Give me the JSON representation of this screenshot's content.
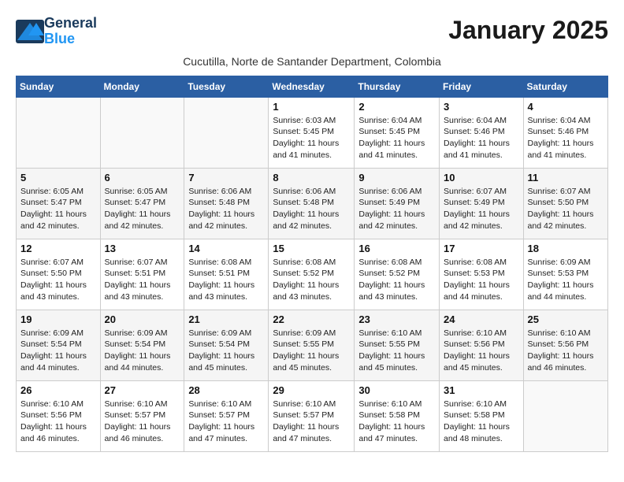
{
  "header": {
    "logo_line1": "General",
    "logo_line2": "Blue",
    "title": "January 2025",
    "subtitle": "Cucutilla, Norte de Santander Department, Colombia"
  },
  "weekdays": [
    "Sunday",
    "Monday",
    "Tuesday",
    "Wednesday",
    "Thursday",
    "Friday",
    "Saturday"
  ],
  "weeks": [
    [
      {
        "day": "",
        "sunrise": "",
        "sunset": "",
        "daylight": ""
      },
      {
        "day": "",
        "sunrise": "",
        "sunset": "",
        "daylight": ""
      },
      {
        "day": "",
        "sunrise": "",
        "sunset": "",
        "daylight": ""
      },
      {
        "day": "1",
        "sunrise": "Sunrise: 6:03 AM",
        "sunset": "Sunset: 5:45 PM",
        "daylight": "Daylight: 11 hours and 41 minutes."
      },
      {
        "day": "2",
        "sunrise": "Sunrise: 6:04 AM",
        "sunset": "Sunset: 5:45 PM",
        "daylight": "Daylight: 11 hours and 41 minutes."
      },
      {
        "day": "3",
        "sunrise": "Sunrise: 6:04 AM",
        "sunset": "Sunset: 5:46 PM",
        "daylight": "Daylight: 11 hours and 41 minutes."
      },
      {
        "day": "4",
        "sunrise": "Sunrise: 6:04 AM",
        "sunset": "Sunset: 5:46 PM",
        "daylight": "Daylight: 11 hours and 41 minutes."
      }
    ],
    [
      {
        "day": "5",
        "sunrise": "Sunrise: 6:05 AM",
        "sunset": "Sunset: 5:47 PM",
        "daylight": "Daylight: 11 hours and 42 minutes."
      },
      {
        "day": "6",
        "sunrise": "Sunrise: 6:05 AM",
        "sunset": "Sunset: 5:47 PM",
        "daylight": "Daylight: 11 hours and 42 minutes."
      },
      {
        "day": "7",
        "sunrise": "Sunrise: 6:06 AM",
        "sunset": "Sunset: 5:48 PM",
        "daylight": "Daylight: 11 hours and 42 minutes."
      },
      {
        "day": "8",
        "sunrise": "Sunrise: 6:06 AM",
        "sunset": "Sunset: 5:48 PM",
        "daylight": "Daylight: 11 hours and 42 minutes."
      },
      {
        "day": "9",
        "sunrise": "Sunrise: 6:06 AM",
        "sunset": "Sunset: 5:49 PM",
        "daylight": "Daylight: 11 hours and 42 minutes."
      },
      {
        "day": "10",
        "sunrise": "Sunrise: 6:07 AM",
        "sunset": "Sunset: 5:49 PM",
        "daylight": "Daylight: 11 hours and 42 minutes."
      },
      {
        "day": "11",
        "sunrise": "Sunrise: 6:07 AM",
        "sunset": "Sunset: 5:50 PM",
        "daylight": "Daylight: 11 hours and 42 minutes."
      }
    ],
    [
      {
        "day": "12",
        "sunrise": "Sunrise: 6:07 AM",
        "sunset": "Sunset: 5:50 PM",
        "daylight": "Daylight: 11 hours and 43 minutes."
      },
      {
        "day": "13",
        "sunrise": "Sunrise: 6:07 AM",
        "sunset": "Sunset: 5:51 PM",
        "daylight": "Daylight: 11 hours and 43 minutes."
      },
      {
        "day": "14",
        "sunrise": "Sunrise: 6:08 AM",
        "sunset": "Sunset: 5:51 PM",
        "daylight": "Daylight: 11 hours and 43 minutes."
      },
      {
        "day": "15",
        "sunrise": "Sunrise: 6:08 AM",
        "sunset": "Sunset: 5:52 PM",
        "daylight": "Daylight: 11 hours and 43 minutes."
      },
      {
        "day": "16",
        "sunrise": "Sunrise: 6:08 AM",
        "sunset": "Sunset: 5:52 PM",
        "daylight": "Daylight: 11 hours and 43 minutes."
      },
      {
        "day": "17",
        "sunrise": "Sunrise: 6:08 AM",
        "sunset": "Sunset: 5:53 PM",
        "daylight": "Daylight: 11 hours and 44 minutes."
      },
      {
        "day": "18",
        "sunrise": "Sunrise: 6:09 AM",
        "sunset": "Sunset: 5:53 PM",
        "daylight": "Daylight: 11 hours and 44 minutes."
      }
    ],
    [
      {
        "day": "19",
        "sunrise": "Sunrise: 6:09 AM",
        "sunset": "Sunset: 5:54 PM",
        "daylight": "Daylight: 11 hours and 44 minutes."
      },
      {
        "day": "20",
        "sunrise": "Sunrise: 6:09 AM",
        "sunset": "Sunset: 5:54 PM",
        "daylight": "Daylight: 11 hours and 44 minutes."
      },
      {
        "day": "21",
        "sunrise": "Sunrise: 6:09 AM",
        "sunset": "Sunset: 5:54 PM",
        "daylight": "Daylight: 11 hours and 45 minutes."
      },
      {
        "day": "22",
        "sunrise": "Sunrise: 6:09 AM",
        "sunset": "Sunset: 5:55 PM",
        "daylight": "Daylight: 11 hours and 45 minutes."
      },
      {
        "day": "23",
        "sunrise": "Sunrise: 6:10 AM",
        "sunset": "Sunset: 5:55 PM",
        "daylight": "Daylight: 11 hours and 45 minutes."
      },
      {
        "day": "24",
        "sunrise": "Sunrise: 6:10 AM",
        "sunset": "Sunset: 5:56 PM",
        "daylight": "Daylight: 11 hours and 45 minutes."
      },
      {
        "day": "25",
        "sunrise": "Sunrise: 6:10 AM",
        "sunset": "Sunset: 5:56 PM",
        "daylight": "Daylight: 11 hours and 46 minutes."
      }
    ],
    [
      {
        "day": "26",
        "sunrise": "Sunrise: 6:10 AM",
        "sunset": "Sunset: 5:56 PM",
        "daylight": "Daylight: 11 hours and 46 minutes."
      },
      {
        "day": "27",
        "sunrise": "Sunrise: 6:10 AM",
        "sunset": "Sunset: 5:57 PM",
        "daylight": "Daylight: 11 hours and 46 minutes."
      },
      {
        "day": "28",
        "sunrise": "Sunrise: 6:10 AM",
        "sunset": "Sunset: 5:57 PM",
        "daylight": "Daylight: 11 hours and 47 minutes."
      },
      {
        "day": "29",
        "sunrise": "Sunrise: 6:10 AM",
        "sunset": "Sunset: 5:57 PM",
        "daylight": "Daylight: 11 hours and 47 minutes."
      },
      {
        "day": "30",
        "sunrise": "Sunrise: 6:10 AM",
        "sunset": "Sunset: 5:58 PM",
        "daylight": "Daylight: 11 hours and 47 minutes."
      },
      {
        "day": "31",
        "sunrise": "Sunrise: 6:10 AM",
        "sunset": "Sunset: 5:58 PM",
        "daylight": "Daylight: 11 hours and 48 minutes."
      },
      {
        "day": "",
        "sunrise": "",
        "sunset": "",
        "daylight": ""
      }
    ]
  ]
}
